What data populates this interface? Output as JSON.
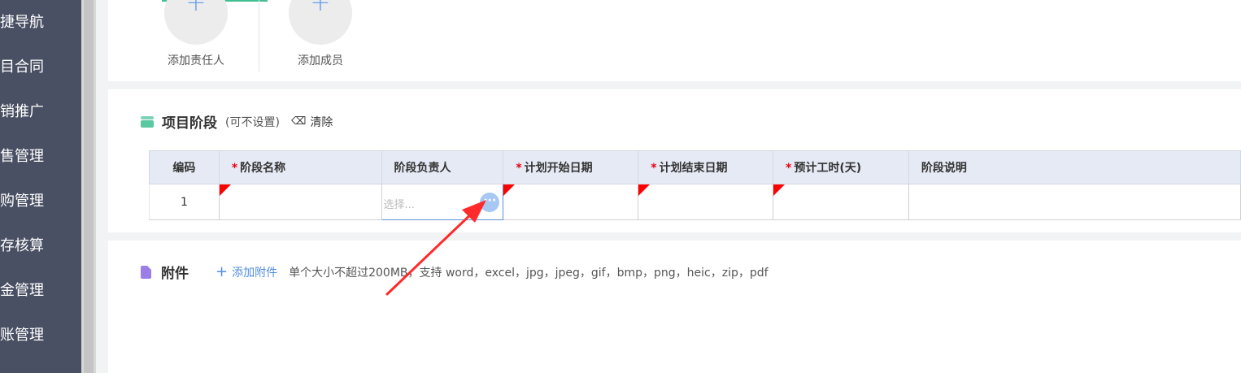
{
  "sidebar": {
    "items": [
      "捷导航",
      "目合同",
      "销推广",
      "售管理",
      "购管理",
      "存核算",
      "金管理",
      "账管理"
    ]
  },
  "members": {
    "add_owner": "添加责任人",
    "add_member": "添加成员",
    "plus": "+"
  },
  "stage": {
    "title": "项目阶段",
    "subtitle": "(可不设置)",
    "clear": "清除",
    "columns": {
      "code": "编码",
      "name": "阶段名称",
      "owner": "阶段负责人",
      "start": "计划开始日期",
      "end": "计划结束日期",
      "hours": "预计工时(天)",
      "desc": "阶段说明"
    },
    "required_mark": "*",
    "row": {
      "index": "1",
      "owner_placeholder": "选择...",
      "more": "···"
    }
  },
  "attachment": {
    "title": "附件",
    "add_label": "添加附件",
    "plus": "+",
    "hint": "单个大小不超过200MB，支持 word，excel，jpg，jpeg，gif，bmp，png，heic，zip，pdf"
  },
  "colors": {
    "sidebar": "#4a5064",
    "accent": "#4f8ee0",
    "required": "#e60012",
    "arrow": "#ff2a2a"
  }
}
